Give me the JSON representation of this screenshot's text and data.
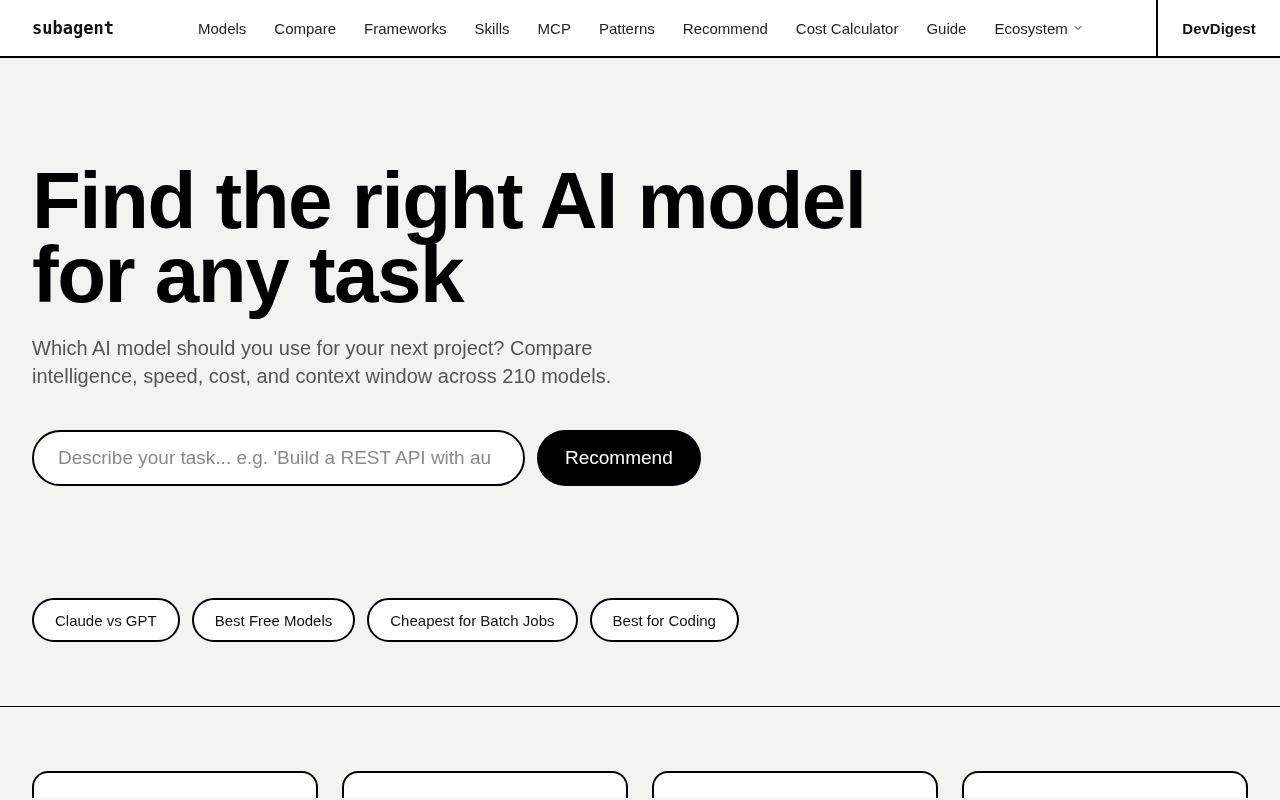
{
  "header": {
    "logo": "subagent",
    "nav": [
      {
        "label": "Models",
        "kind": "link"
      },
      {
        "label": "Compare",
        "kind": "link"
      },
      {
        "label": "Frameworks",
        "kind": "link"
      },
      {
        "label": "Skills",
        "kind": "link"
      },
      {
        "label": "MCP",
        "kind": "link"
      },
      {
        "label": "Patterns",
        "kind": "link"
      },
      {
        "label": "Recommend",
        "kind": "link"
      },
      {
        "label": "Cost Calculator",
        "kind": "link"
      },
      {
        "label": "Guide",
        "kind": "link"
      },
      {
        "label": "Ecosystem",
        "kind": "dropdown"
      }
    ],
    "side_link": "DevDigest"
  },
  "hero": {
    "title": "Find the right AI model for any task",
    "subtitle": "Which AI model should you use for your next project? Compare intelligence, speed, cost, and context window across 210 models.",
    "search": {
      "placeholder": "Describe your task... e.g. 'Build a REST API with au"
    },
    "submit": "Recommend",
    "chips": [
      "Claude vs GPT",
      "Best Free Models",
      "Cheapest for Batch Jobs",
      "Best for Coding"
    ]
  }
}
